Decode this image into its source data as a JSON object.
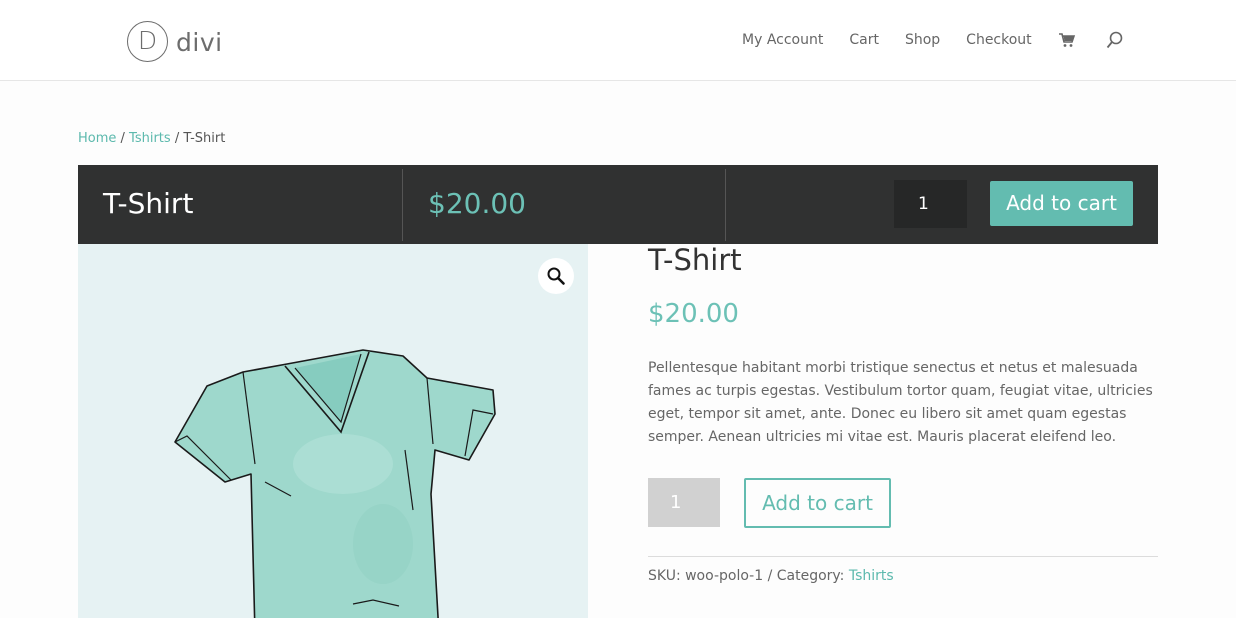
{
  "header": {
    "logo_letter": "D",
    "logo_text": "divi",
    "nav": {
      "my_account": "My Account",
      "cart": "Cart",
      "shop": "Shop",
      "checkout": "Checkout"
    },
    "cart_icon": "cart-icon",
    "search_icon": "search-icon"
  },
  "breadcrumb": {
    "home": "Home",
    "sep1": " / ",
    "category": "Tshirts",
    "sep2": " / ",
    "current": "T-Shirt"
  },
  "sticky_bar": {
    "title": "T-Shirt",
    "price": "$20.00",
    "quantity": "1",
    "add_label": "Add to cart"
  },
  "product": {
    "title": "T-Shirt",
    "price": "$20.00",
    "description": "Pellentesque habitant morbi tristique senectus et netus et malesuada fames ac turpis egestas. Vestibulum tortor quam, feugiat vitae, ultricies eget, tempor sit amet, ante. Donec eu libero sit amet quam egestas semper. Aenean ultricies mi vitae est. Mauris placerat eleifend leo.",
    "quantity": "1",
    "add_label": "Add to cart",
    "sku_text": "SKU: woo-polo-1 / Category: ",
    "category_link": "Tshirts",
    "zoom_icon": "magnifier-icon"
  },
  "colors": {
    "accent": "#63bcb0",
    "bar_bg": "#303131",
    "image_bg": "#e6f2f3"
  }
}
